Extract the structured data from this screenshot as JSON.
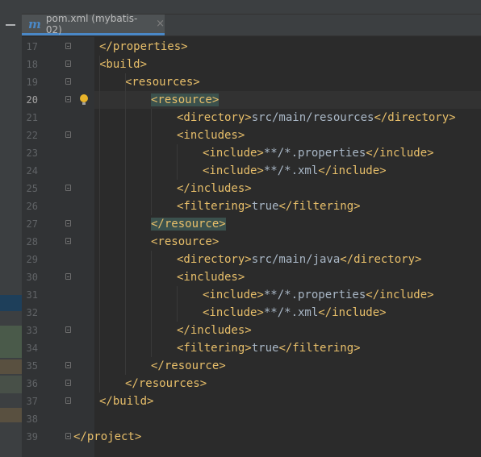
{
  "tab": {
    "icon_letter": "m",
    "title": "pom.xml (mybatis-02)",
    "close": "×"
  },
  "colors": {
    "tag": "#e8bf6a",
    "text": "#a9b7c6",
    "tab_underline": "#4a88c7",
    "match_highlight": "#3b514d"
  },
  "lines": [
    {
      "num": "17",
      "indent": 1,
      "segments": [
        {
          "t": "</properties>",
          "k": "tag"
        }
      ],
      "fold": "open"
    },
    {
      "num": "18",
      "indent": 1,
      "segments": [
        {
          "t": "<build>",
          "k": "tag"
        }
      ],
      "fold": "open"
    },
    {
      "num": "19",
      "indent": 2,
      "segments": [
        {
          "t": "<resources>",
          "k": "tag"
        }
      ],
      "fold": "open"
    },
    {
      "num": "20",
      "indent": 3,
      "segments": [
        {
          "t": "<resource>",
          "k": "tag",
          "hl": true
        }
      ],
      "fold": "open",
      "current": true,
      "bulb": true
    },
    {
      "num": "21",
      "indent": 4,
      "segments": [
        {
          "t": "<directory>",
          "k": "tag"
        },
        {
          "t": "src/main/resources",
          "k": "txt"
        },
        {
          "t": "</directory>",
          "k": "tag"
        }
      ]
    },
    {
      "num": "22",
      "indent": 4,
      "segments": [
        {
          "t": "<includes>",
          "k": "tag"
        }
      ],
      "fold": "open"
    },
    {
      "num": "23",
      "indent": 5,
      "segments": [
        {
          "t": "<include>",
          "k": "tag"
        },
        {
          "t": "**/*.properties",
          "k": "txt"
        },
        {
          "t": "</include>",
          "k": "tag"
        }
      ]
    },
    {
      "num": "24",
      "indent": 5,
      "segments": [
        {
          "t": "<include>",
          "k": "tag"
        },
        {
          "t": "**/*.xml",
          "k": "txt"
        },
        {
          "t": "</include>",
          "k": "tag"
        }
      ]
    },
    {
      "num": "25",
      "indent": 4,
      "segments": [
        {
          "t": "</includes>",
          "k": "tag"
        }
      ],
      "fold": "close"
    },
    {
      "num": "26",
      "indent": 4,
      "segments": [
        {
          "t": "<filtering>",
          "k": "tag"
        },
        {
          "t": "true",
          "k": "txt"
        },
        {
          "t": "</filtering>",
          "k": "tag"
        }
      ]
    },
    {
      "num": "27",
      "indent": 3,
      "segments": [
        {
          "t": "</resource>",
          "k": "tag",
          "hl": true
        }
      ],
      "fold": "close"
    },
    {
      "num": "28",
      "indent": 3,
      "segments": [
        {
          "t": "<resource>",
          "k": "tag"
        }
      ],
      "fold": "open"
    },
    {
      "num": "29",
      "indent": 4,
      "segments": [
        {
          "t": "<directory>",
          "k": "tag"
        },
        {
          "t": "src/main/java",
          "k": "txt"
        },
        {
          "t": "</directory>",
          "k": "tag"
        }
      ]
    },
    {
      "num": "30",
      "indent": 4,
      "segments": [
        {
          "t": "<includes>",
          "k": "tag"
        }
      ],
      "fold": "open"
    },
    {
      "num": "31",
      "indent": 5,
      "segments": [
        {
          "t": "<include>",
          "k": "tag"
        },
        {
          "t": "**/*.properties",
          "k": "txt"
        },
        {
          "t": "</include>",
          "k": "tag"
        }
      ]
    },
    {
      "num": "32",
      "indent": 5,
      "segments": [
        {
          "t": "<include>",
          "k": "tag"
        },
        {
          "t": "**/*.xml",
          "k": "txt"
        },
        {
          "t": "</include>",
          "k": "tag"
        }
      ]
    },
    {
      "num": "33",
      "indent": 4,
      "segments": [
        {
          "t": "</includes>",
          "k": "tag"
        }
      ],
      "fold": "close"
    },
    {
      "num": "34",
      "indent": 4,
      "segments": [
        {
          "t": "<filtering>",
          "k": "tag"
        },
        {
          "t": "true",
          "k": "txt"
        },
        {
          "t": "</filtering>",
          "k": "tag"
        }
      ]
    },
    {
      "num": "35",
      "indent": 3,
      "segments": [
        {
          "t": "</resource>",
          "k": "tag"
        }
      ],
      "fold": "close"
    },
    {
      "num": "36",
      "indent": 2,
      "segments": [
        {
          "t": "</resources>",
          "k": "tag"
        }
      ],
      "fold": "close"
    },
    {
      "num": "37",
      "indent": 1,
      "segments": [
        {
          "t": "</build>",
          "k": "tag"
        }
      ],
      "fold": "close"
    },
    {
      "num": "38",
      "indent": 0,
      "segments": []
    },
    {
      "num": "39",
      "indent": 0,
      "segments": [
        {
          "t": "</project>",
          "k": "tag"
        }
      ],
      "fold": "close"
    }
  ]
}
